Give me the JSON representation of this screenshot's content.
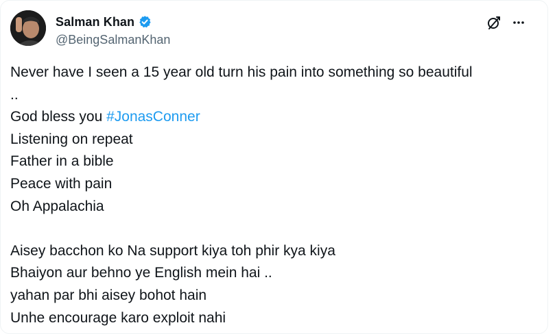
{
  "author": {
    "name": "Salman Khan",
    "handle": "@BeingSalmanKhan",
    "verified": true
  },
  "icons": {
    "verified": "verified-badge-icon",
    "grok": "grok-icon",
    "more": "more-options-icon"
  },
  "colors": {
    "link": "#1d9bf0",
    "text": "#0f1419",
    "muted": "#536471",
    "badge": "#1d9bf0"
  },
  "tweet": {
    "line1": "Never have I seen a 15 year old turn his pain into something so beautiful",
    "line2": "..",
    "line3_prefix": "God bless you ",
    "hashtag": "#JonasConner",
    "line4": "Listening on repeat",
    "line5": "Father in a bible",
    "line6": "Peace with pain",
    "line7": "Oh Appalachia",
    "line8": "Aisey bacchon ko Na support kiya toh phir kya kiya",
    "line9": "Bhaiyon aur behno ye English mein hai ..",
    "line10": "yahan par bhi aisey bohot hain",
    "line11": "Unhe encourage karo exploit nahi"
  }
}
